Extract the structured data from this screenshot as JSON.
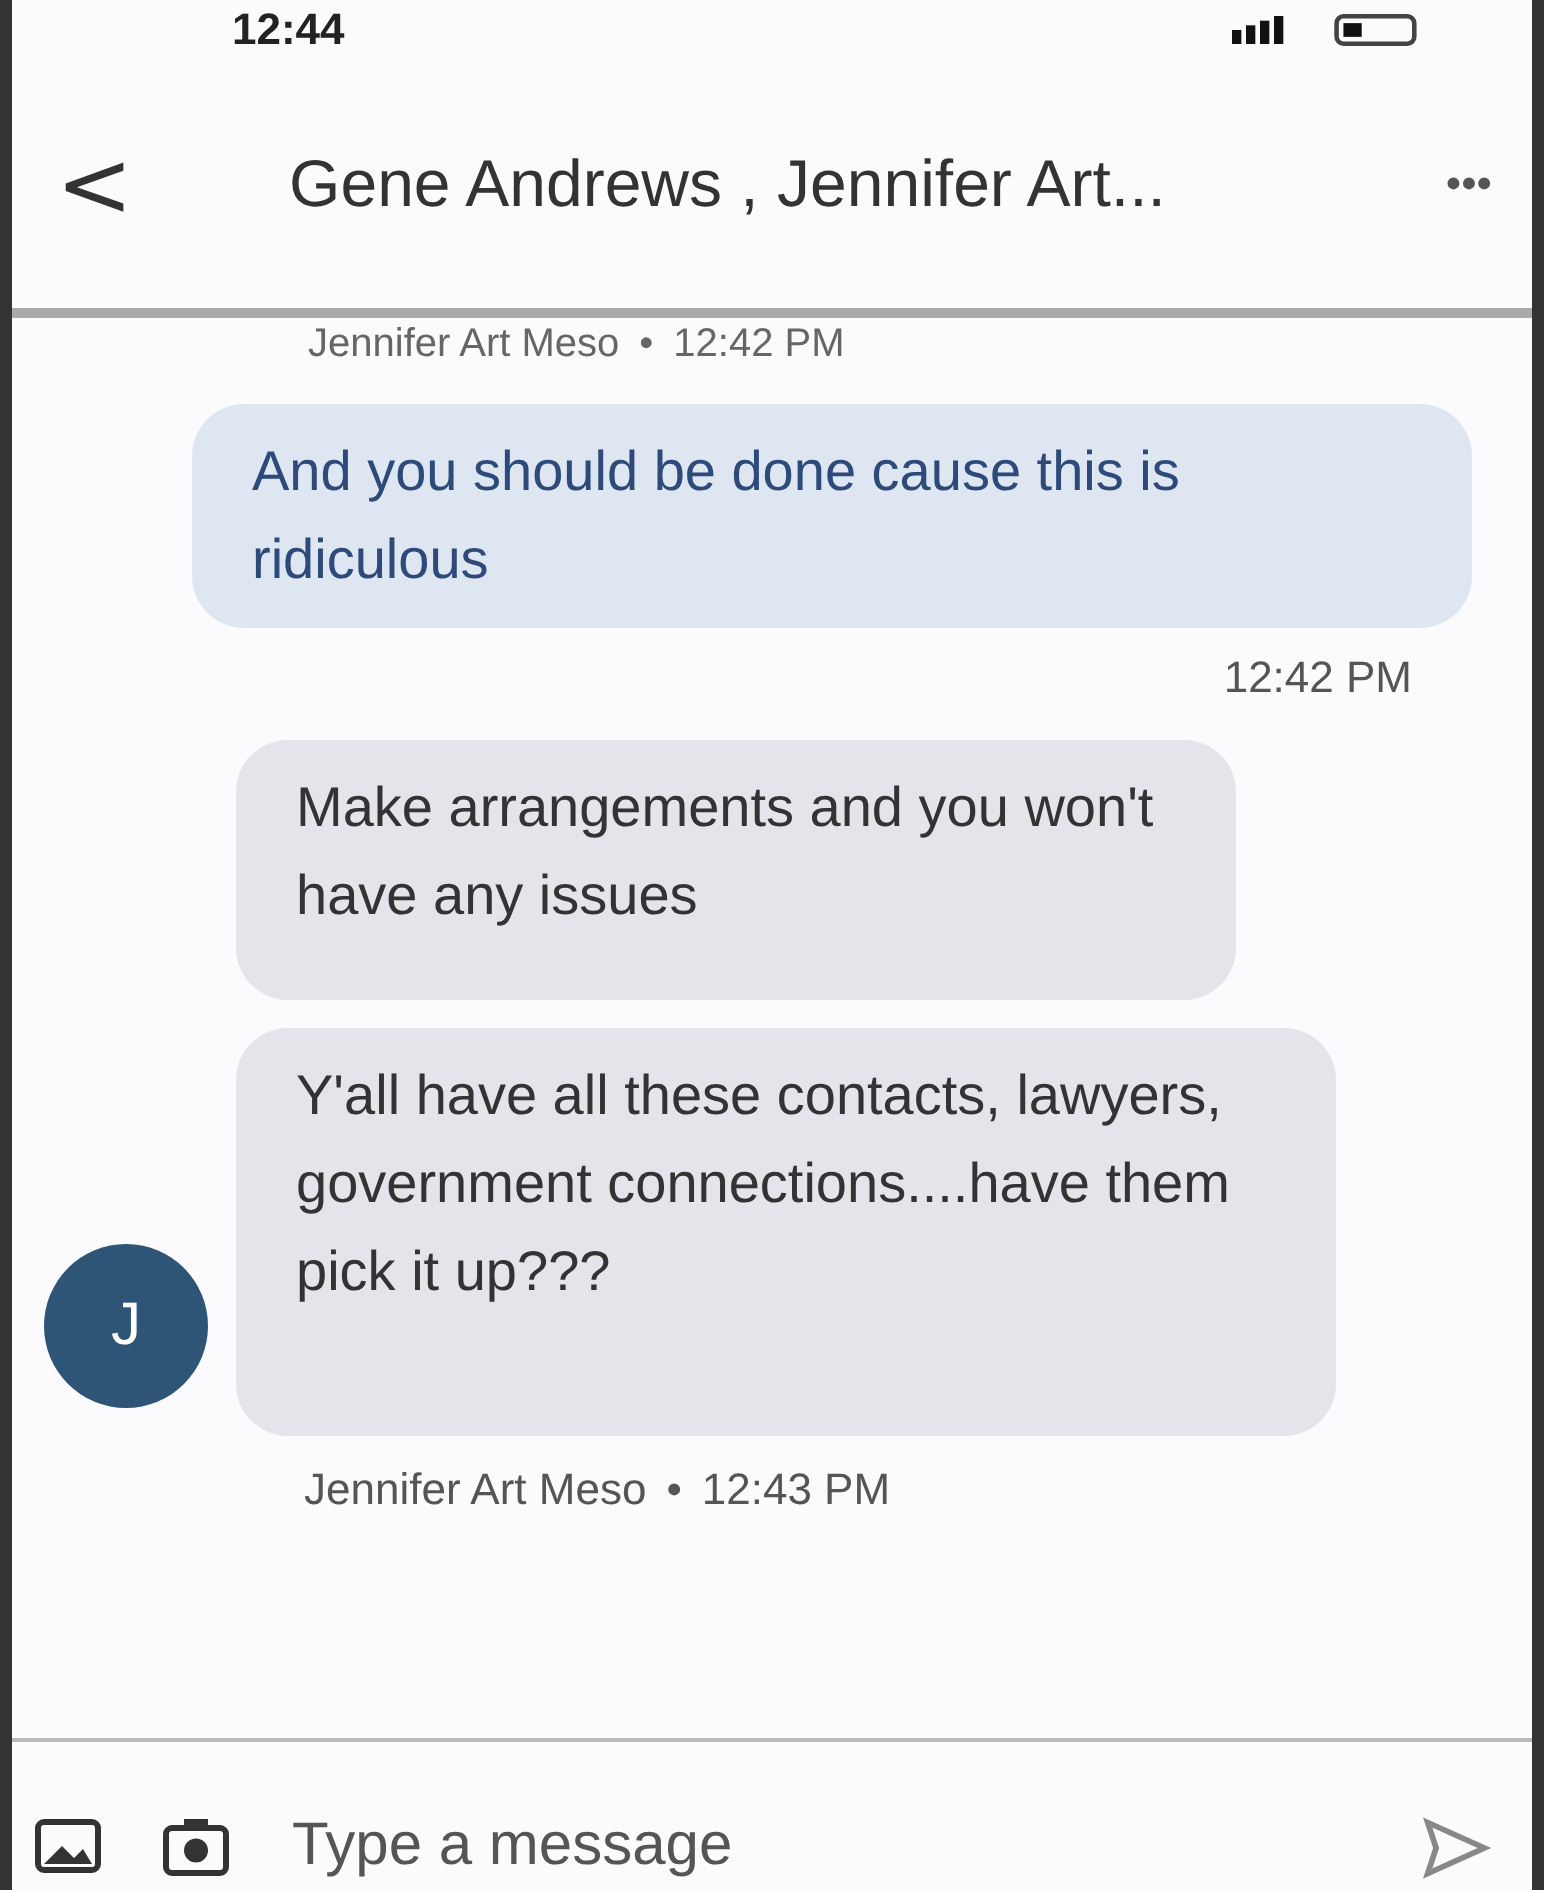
{
  "status_bar": {
    "time": "12:44"
  },
  "header": {
    "back": "<",
    "title": "Gene  Andrews , Jennifer Art...",
    "more": "•••"
  },
  "top_sender": {
    "name": "Jennifer Art Meso",
    "separator": "•",
    "time": "12:42 PM"
  },
  "messages": [
    {
      "kind": "outgoing",
      "text": "And you should be done cause this is ridiculous",
      "time": "12:42 PM"
    },
    {
      "kind": "incoming",
      "text": "Make arrangements and you won't have any issues"
    },
    {
      "kind": "incoming",
      "text": "Y'all have all these contacts, lawyers, government connections....have them pick it up???"
    }
  ],
  "group_footer": {
    "avatar": "J",
    "name": "Jennifer Art Meso",
    "separator": "•",
    "time": "12:43 PM"
  },
  "composer": {
    "placeholder": "Type a message"
  }
}
